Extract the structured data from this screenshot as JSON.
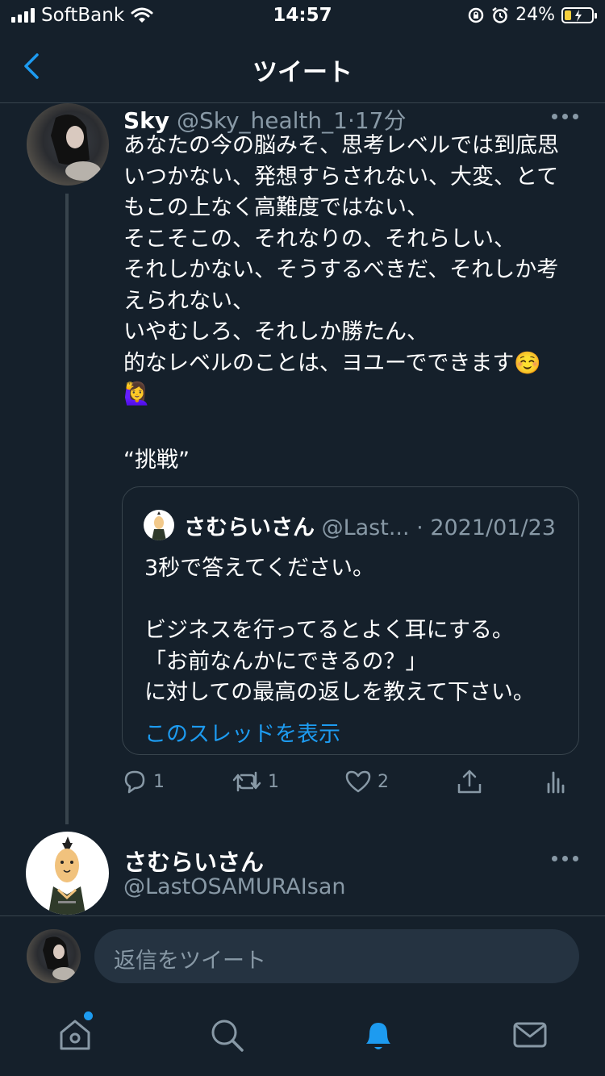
{
  "status_bar": {
    "carrier": "SoftBank",
    "time": "14:57",
    "battery": "24%",
    "battery_level": 0.24
  },
  "nav": {
    "title": "ツイート"
  },
  "tweet": {
    "name": "Sky",
    "handle_time": " @Sky_health_1·17分",
    "lines": [
      "あなたの今の脳みそ、思考レベルでは到底思",
      "いつかない、発想すらされない、大変、とて",
      "もこの上なく高難度ではない、",
      "そこそこの、それなりの、それらしい、",
      "それしかない、そうするべきだ、それしか考",
      "えられない、",
      "いやむしろ、それしか勝たん、",
      "的なレベルのことは、ヨユーでできます☺️",
      "🙋‍♀️"
    ],
    "quote_line": "“挑戦”",
    "quoted": {
      "name": "さむらいさん",
      "meta": " @Last... · 2021/01/23",
      "lines": [
        "3秒で答えてください。",
        "",
        "ビジネスを行ってるとよく耳にする。",
        "「お前なんかにできるの？」",
        "に対しての最高の返しを教えて下さい。"
      ],
      "thread_link": "このスレッドを表示"
    },
    "actions": {
      "reply_count": "1",
      "retweet_count": "1",
      "like_count": "2"
    }
  },
  "next_tweet": {
    "name": "さむらいさん",
    "handle": "@LastOSAMURAIsan"
  },
  "reply": {
    "placeholder": "返信をツイート"
  },
  "tabs": [
    "home-icon",
    "search-icon",
    "notifications-icon",
    "messages-icon"
  ],
  "colors": {
    "background": "#15202b",
    "accent": "#1d9bf0",
    "muted": "#8899a6"
  }
}
